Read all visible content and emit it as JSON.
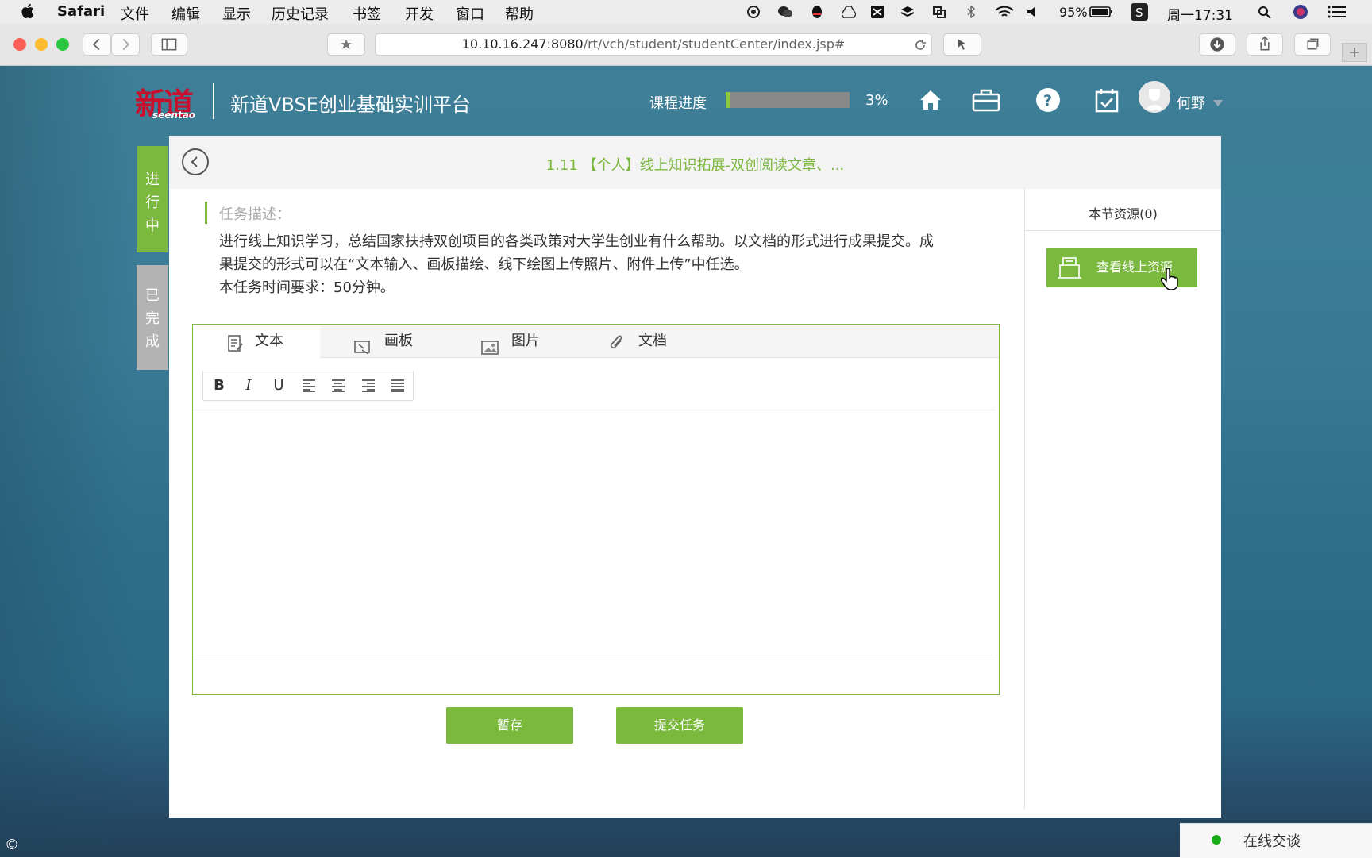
{
  "menubar": {
    "app": "Safari",
    "items": [
      "文件",
      "编辑",
      "显示",
      "历史记录",
      "书签",
      "开发",
      "窗口",
      "帮助"
    ],
    "battery": "95%",
    "clock": "周一17:31"
  },
  "browser": {
    "url_host": "10.10.16.247:8080",
    "url_path": "/rt/vch/student/studentCenter/index.jsp#"
  },
  "header": {
    "logo_cn": "新道",
    "logo_en": "seentao",
    "title": "新道VBSE创业基础实训平台",
    "progress_label": "课程进度",
    "progress_value": 0.03,
    "progress_text": "3%",
    "user": "何野"
  },
  "side_tabs": {
    "in_progress": "进行中",
    "done": "已完成"
  },
  "task": {
    "title": "1.11 【个人】线上知识拓展-双创阅读文章、...",
    "desc_label": "任务描述：",
    "desc_line1": "进行线上知识学习，总结国家扶持双创项目的各类政策对大学生创业有什么帮助。以文档的形式进行成果提交。成",
    "desc_line2": "果提交的形式可以在“文本输入、画板描绘、线下绘图上传照片、附件上传”中任选。",
    "desc_line3": "本任务时间要求：50分钟。"
  },
  "editor": {
    "tabs": [
      "文本",
      "画板",
      "图片",
      "文档"
    ],
    "format_buttons": [
      "B",
      "I",
      "U"
    ]
  },
  "actions": {
    "save": "暂存",
    "submit": "提交任务"
  },
  "resources": {
    "label": "本节资源(0)",
    "view_online": "查看线上资源"
  },
  "chat": {
    "label": "在线交谈"
  },
  "colors": {
    "accent": "#7ab83e",
    "logo_red": "#c8102e"
  }
}
